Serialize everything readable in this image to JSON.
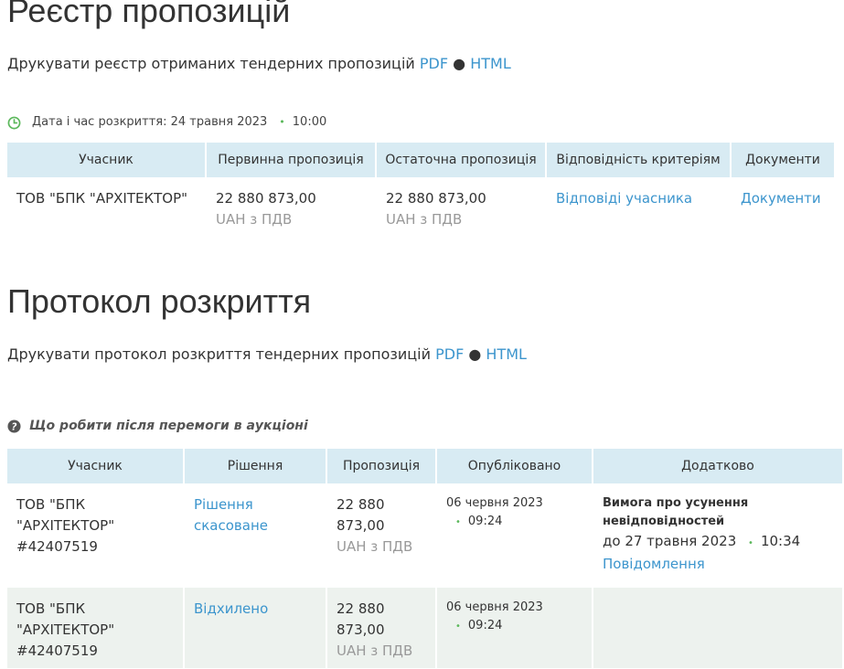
{
  "registry": {
    "title": "Реєстр пропозицій",
    "print_text": "Друкувати реєстр отриманих тендерних пропозицій",
    "pdf": "PDF",
    "sep": "●",
    "html": "HTML",
    "opening_label": "Дата і час розкриття: 24 травня 2023",
    "opening_time": "10:00",
    "dot": "•",
    "headers": [
      "Учасник",
      "Первинна пропозиція",
      "Остаточна пропозиція",
      "Відповідність критеріям",
      "Документи"
    ],
    "row": {
      "participant": "ТОВ \"БПК \"АРХІТЕКТОР\"",
      "initial_amount": "22 880 873,00",
      "initial_currency": "UAH з ПДВ",
      "final_amount": "22 880 873,00",
      "final_currency": "UAH з ПДВ",
      "criteria_link": "Відповіді учасника",
      "documents_link": "Документи"
    }
  },
  "protocol": {
    "title": "Протокол розкриття",
    "print_text": "Друкувати протокол розкриття тендерних пропозицій",
    "pdf": "PDF",
    "sep": "●",
    "html": "HTML",
    "help_text": "Що робити після перемоги в аукціоні",
    "headers": [
      "Учасник",
      "Рішення",
      "Пропозиція",
      "Опубліковано",
      "Додатково"
    ],
    "rows": [
      {
        "participant_l1": "ТОВ \"БПК",
        "participant_l2": "\"АРХІТЕКТОР\"",
        "participant_l3": "#42407519",
        "decision_l1": "Рішення",
        "decision_l2": "скасоване",
        "amount_l1": "22 880",
        "amount_l2": "873,00",
        "currency": "UAH з ПДВ",
        "published_date": "06 червня 2023",
        "published_time": "09:24",
        "extra_title_l1": "Вимога про усунення",
        "extra_title_l2": "невідповідностей",
        "extra_deadline": "до 27 травня 2023",
        "extra_time": "10:34",
        "extra_link": "Повідомлення"
      },
      {
        "participant_l1": "ТОВ \"БПК",
        "participant_l2": "\"АРХІТЕКТОР\"",
        "participant_l3": "#42407519",
        "decision_l1": "Відхилено",
        "amount_l1": "22 880",
        "amount_l2": "873,00",
        "currency": "UAH з ПДВ",
        "published_date": "06 червня 2023",
        "published_time": "09:24"
      }
    ]
  },
  "colors": {
    "link": "#3c95cd",
    "header_bg": "#d8ebf3",
    "green": "#5cb85c",
    "row_alt": "#edf2ee"
  }
}
